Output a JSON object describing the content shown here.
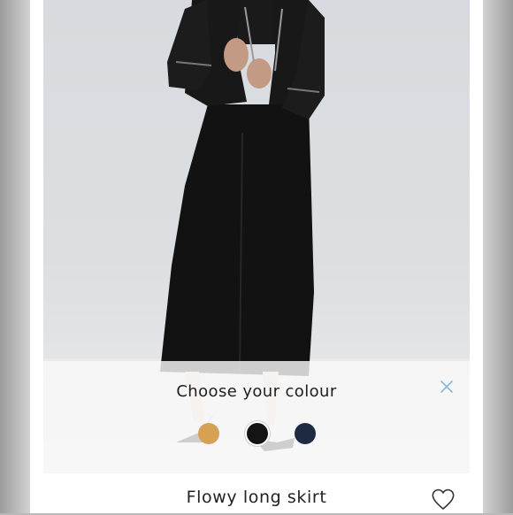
{
  "product": {
    "name": "Flowy long skirt"
  },
  "colour_picker": {
    "title": "Choose your colour",
    "selected_index": 1,
    "swatches": [
      {
        "name": "mustard",
        "color": "#D6A155"
      },
      {
        "name": "black",
        "color": "#141414"
      },
      {
        "name": "navy",
        "color": "#1D2A42"
      }
    ]
  },
  "icons": {
    "close": "close-icon",
    "wishlist": "heart-icon"
  },
  "colors": {
    "close_icon": "#8CB6DA",
    "text": "#1F1F1F"
  }
}
